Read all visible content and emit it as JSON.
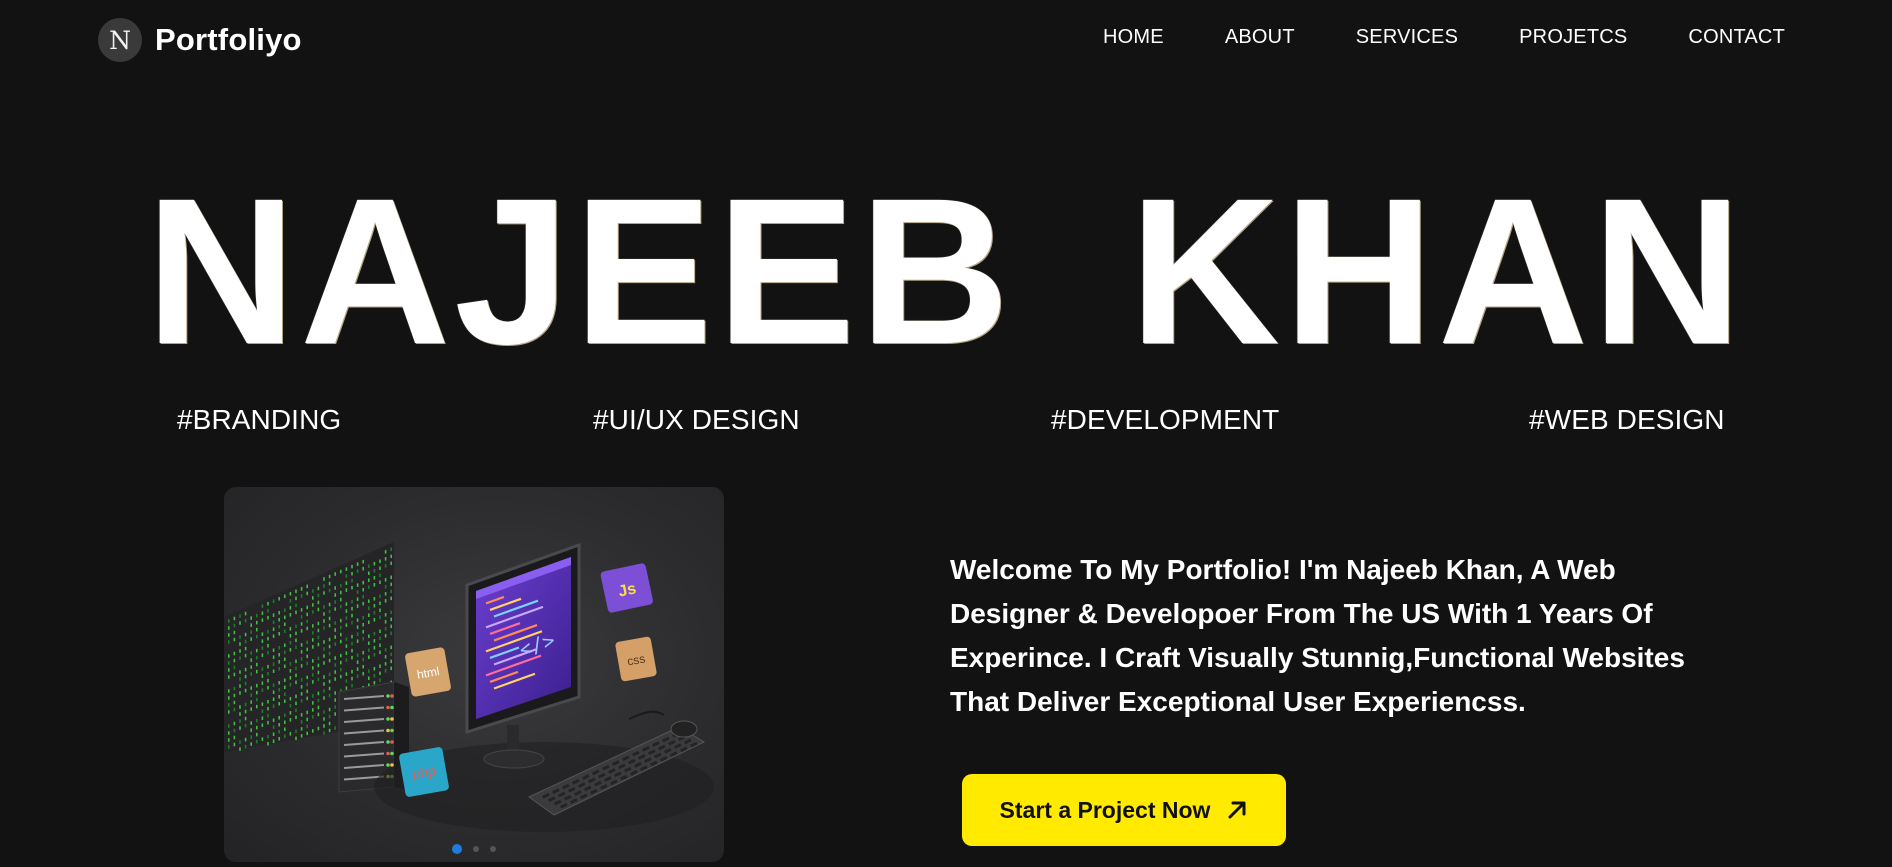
{
  "header": {
    "logo_badge": "N",
    "brand": "Portfoliyo",
    "nav": [
      {
        "label": "HOME"
      },
      {
        "label": "ABOUT"
      },
      {
        "label": "SERVICES"
      },
      {
        "label": "PROJETCS"
      },
      {
        "label": "CONTACT"
      }
    ]
  },
  "hero": {
    "name": "NAJEEB KHAN",
    "tags": [
      "#BRANDING",
      "#UI/UX DESIGN",
      "#DEVELOPMENT",
      "#WEB DESIGN"
    ]
  },
  "slider": {
    "badges": [
      "Js",
      "css",
      "html",
      "php"
    ],
    "active_slide": 0,
    "slide_count": 3
  },
  "intro": {
    "text": "Welcome To My Portfolio! I'm Najeeb Khan, A Web Designer & Developoer From The US With 1 Years Of Experince. I Craft Visually Stunnig,Functional Websites That Deliver Exceptional User Experiencss."
  },
  "cta": {
    "label": "Start a Project Now",
    "icon": "arrow-up-right-icon"
  },
  "colors": {
    "background": "#121212",
    "accent": "#ffea00",
    "slider_dot_active": "#1e7be0"
  }
}
